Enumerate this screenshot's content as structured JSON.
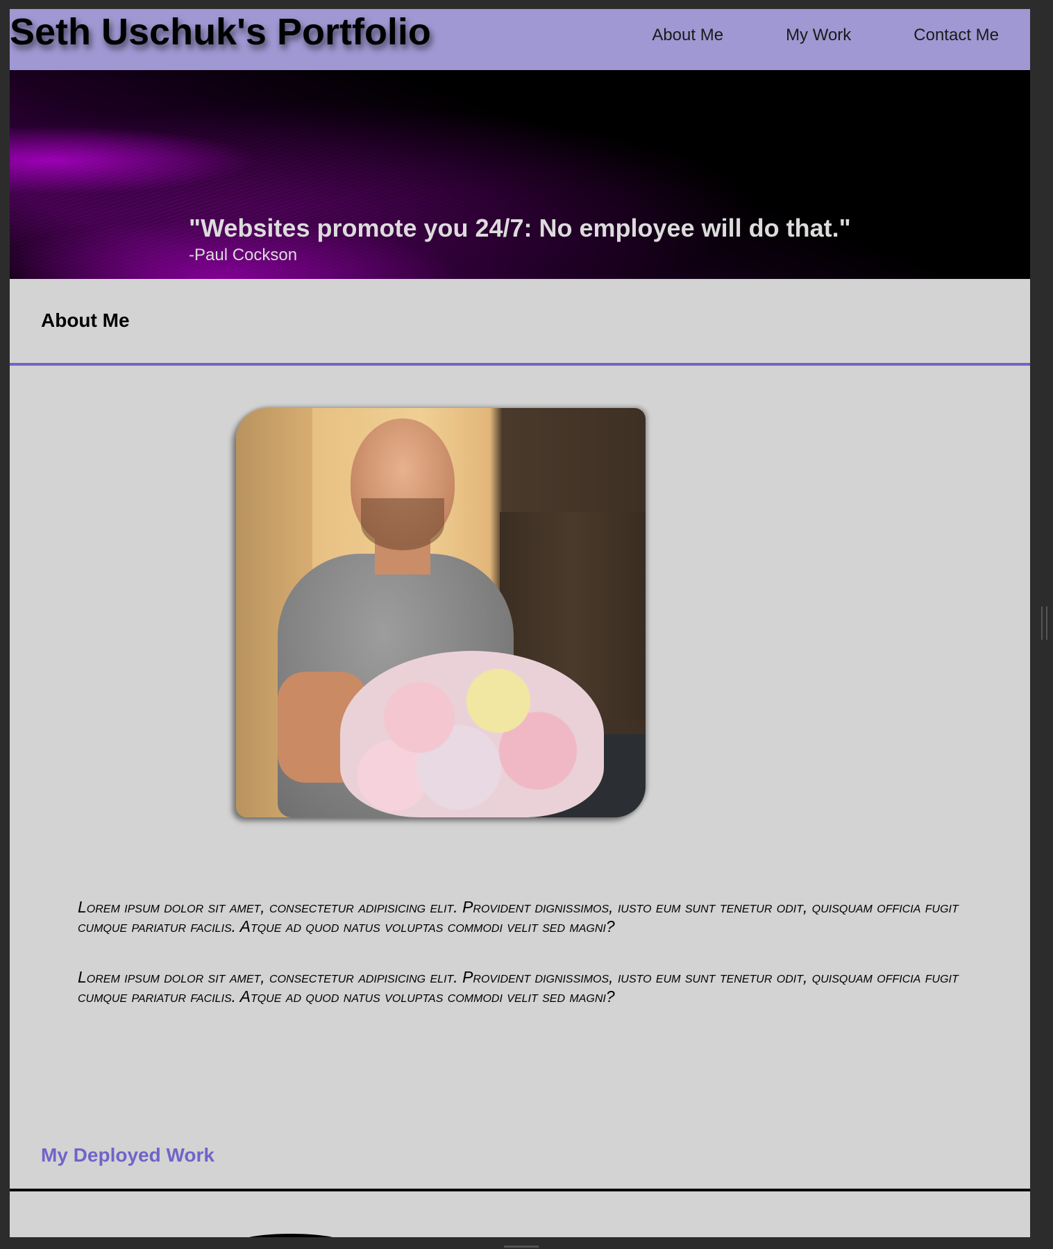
{
  "header": {
    "title": "Seth Uschuk's Portfolio",
    "nav": [
      "About Me",
      "My Work",
      "Contact Me"
    ]
  },
  "hero": {
    "quote": "\"Websites promote you 24/7: No employee will do that.\"",
    "author": "-Paul Cockson"
  },
  "about": {
    "heading": "About Me",
    "paragraphs": [
      "Lorem ipsum dolor sit amet, consectetur adipisicing elit. Provident dignissimos, iusto eum sunt tenetur odit, quisquam officia fugit cumque pariatur facilis. Atque ad quod natus voluptas commodi velit sed magni?",
      "Lorem ipsum dolor sit amet, consectetur adipisicing elit. Provident dignissimos, iusto eum sunt tenetur odit, quisquam officia fugit cumque pariatur facilis. Atque ad quod natus voluptas commodi velit sed magni?"
    ]
  },
  "work": {
    "heading": "My Deployed Work"
  },
  "colors": {
    "header_bg": "#9f98d2",
    "accent": "#6f64c9",
    "page_bg": "#d3d3d3",
    "frame_bg": "#2c2c2c"
  }
}
